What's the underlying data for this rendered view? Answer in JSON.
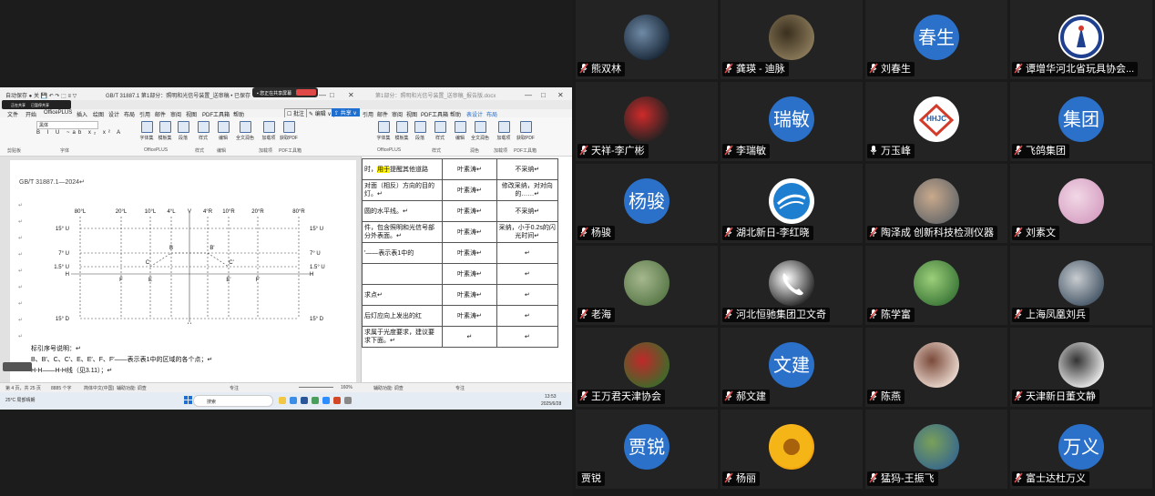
{
  "shared_screen": {
    "share_bar": {
      "label": "▪ 您正在共享屏幕",
      "stop_label": "停止共享"
    },
    "mini_toolbar": {
      "items": [
        "正在共享",
        "已暂停共享"
      ]
    },
    "title_left": "自动保存 ● 关 💾 ↶ ↷ ⬚ ≡ ▽",
    "title_doc": "GB/T 31887.1 第1部分：照明和光信号装置_送审稿 • 已保存 ∨",
    "title_doc_right": "第1部分：照明和光信号装置_送审稿_报告版.docx",
    "window_buttons": [
      "—",
      "□",
      "✕"
    ],
    "menu_left": [
      "文件",
      "开始",
      "OfficePLUS",
      "插入",
      "绘图",
      "设计",
      "布局",
      "引用",
      "邮件",
      "审阅",
      "视图",
      "PDF工具箱",
      "帮助"
    ],
    "menu_right": [
      "引用",
      "邮件",
      "审阅",
      "视图",
      "PDF工具箱",
      "帮助",
      "表设计",
      "布局"
    ],
    "ribbon_buttons": {
      "comment": "☐ 批注",
      "edit": "✎ 编辑 ∨",
      "share": "⇪ 共享 ∨"
    },
    "font_name": "黑体",
    "format_row": "B I U ~ab x₂ x² A",
    "ribbon_items": [
      "字体集",
      "模板集",
      "段落",
      "样式",
      "编辑",
      "全文润色",
      "加载项",
      "获取PDF"
    ],
    "ribbon_groups": [
      "剪贴板",
      "字体",
      "OfficePLUS",
      "样式",
      "编辑",
      "加载项",
      "PDF工具箱"
    ],
    "ribbon_items_right": [
      "字体集",
      "模板集",
      "段落",
      "样式",
      "编辑",
      "全文润色",
      "加载项",
      "获取PDF"
    ],
    "ribbon_groups_right": [
      "OfficePLUS",
      "样式",
      "润色",
      "加载项",
      "PDF工具箱"
    ],
    "doc_header": "GB/T 31887.1—2024↵",
    "diagram": {
      "top_labels": [
        "80°L",
        "20°L",
        "10°L",
        "4°L",
        "V",
        "4°R",
        "10°R",
        "20°R",
        "80°R"
      ],
      "left_labels": [
        "15° U",
        "7° U",
        "1.5° U",
        "H",
        "15° D"
      ],
      "right_labels": [
        "15° U",
        "7° U",
        "1.5° U",
        "H",
        "15° D"
      ],
      "points": [
        "B",
        "B'",
        "C",
        "C'",
        "F",
        "E",
        "E'",
        "F'"
      ],
      "bottom_v": "V"
    },
    "doc_lines": [
      "标引序号说明：↵",
      "B、B′、C、C′、E、E′、F、F′——表示表1中的区域的各个点；↵",
      "H-H——H-H线（见3.11）；↵"
    ],
    "right_table": [
      {
        "c1": "时，用于提醒其他道路",
        "c1_hl": "用于",
        "c2": "叶素涛↵",
        "c3": "不采纳↵"
      },
      {
        "c1": "对面（相反）方向的目的灯。↵",
        "c2": "叶素涛↵",
        "c3": "修改采纳，对对向的……↵"
      },
      {
        "c1": "圆的水平线。↵",
        "c2": "叶素涛↵",
        "c3": "不采纳↵"
      },
      {
        "c1": "件，包含照明和光信号部分外表面。↵",
        "c2": "叶素涛↵",
        "c3": "采纳，小于0.2s的闪光时间↵"
      },
      {
        "c1": "′——表示表1中的",
        "c2": "叶素涛↵",
        "c3": "↵"
      },
      {
        "c1": "",
        "c2": "叶素涛↵",
        "c3": "↵"
      },
      {
        "c1": "求点↵",
        "c2": "叶素涛↵",
        "c3": "↵"
      },
      {
        "c1": "后灯应向上发出的红",
        "c2": "叶素涛↵",
        "c3": "↵"
      },
      {
        "c1": "求属于光度要求，建议要求下面。↵",
        "c2": "↵",
        "c3": "↵"
      }
    ],
    "status_left": [
      "第 4 页，共 25 页",
      "8885 个字",
      "简体中文(中国)",
      "辅助功能: 调查"
    ],
    "status_right": [
      "辅助功能: 调查",
      "专注",
      "160%"
    ],
    "taskbar": {
      "weather": "25°C 局部晴朗",
      "search_placeholder": "搜索",
      "clock_time": "13:53",
      "clock_date": "2025/6/28"
    }
  },
  "participants": [
    {
      "name": "熊双林",
      "muted": true,
      "avatar_type": "photo",
      "photo": "night-city"
    },
    {
      "name": "龚瑛 - 迪脉",
      "muted": true,
      "avatar_type": "photo",
      "photo": "tree-silhouette"
    },
    {
      "name": "刘春生",
      "muted": true,
      "avatar_type": "text",
      "avatar_text": "春生"
    },
    {
      "name": "谭增华河北省玩具协会...",
      "muted": true,
      "avatar_type": "logo",
      "photo": "emblem"
    },
    {
      "name": "天祥-李广彬",
      "muted": true,
      "avatar_type": "photo",
      "photo": "mushroom-character"
    },
    {
      "name": "李瑞敏",
      "muted": true,
      "avatar_type": "text",
      "avatar_text": "瑞敏"
    },
    {
      "name": "万玉峰",
      "muted": false,
      "avatar_type": "logo",
      "photo": "hhjc-logo",
      "logo_text": "HHJC"
    },
    {
      "name": "飞鸽集团",
      "muted": true,
      "avatar_type": "text",
      "avatar_text": "集团"
    },
    {
      "name": "杨骏",
      "muted": true,
      "avatar_type": "text",
      "avatar_text": "杨骏"
    },
    {
      "name": "湖北新日-李红晓",
      "muted": true,
      "avatar_type": "logo",
      "photo": "blue-swoosh-logo"
    },
    {
      "name": "陶泽成 创新科技检测仪器",
      "muted": true,
      "avatar_type": "photo",
      "photo": "child-camera"
    },
    {
      "name": "刘素文",
      "muted": true,
      "avatar_type": "photo",
      "photo": "pink-flowers"
    },
    {
      "name": "老海",
      "muted": true,
      "avatar_type": "photo",
      "photo": "village-scene"
    },
    {
      "name": "河北恒驰集团卫文奇",
      "muted": true,
      "avatar_type": "logo",
      "photo": "phone-icon"
    },
    {
      "name": "陈学富",
      "muted": true,
      "avatar_type": "photo",
      "photo": "green-bamboo"
    },
    {
      "name": "上海凤凰刘兵",
      "muted": true,
      "avatar_type": "photo",
      "photo": "mountain-sky"
    },
    {
      "name": "王万君天津协会",
      "muted": true,
      "avatar_type": "photo",
      "photo": "red-fruits"
    },
    {
      "name": "郝文建",
      "muted": true,
      "avatar_type": "text",
      "avatar_text": "文建"
    },
    {
      "name": "陈燕",
      "muted": true,
      "avatar_type": "photo",
      "photo": "little-girl"
    },
    {
      "name": "天津新日董文静",
      "muted": true,
      "avatar_type": "photo",
      "photo": "white-cat"
    },
    {
      "name": "贾锐",
      "muted": null,
      "avatar_type": "text",
      "avatar_text": "贾锐"
    },
    {
      "name": "杨丽",
      "muted": true,
      "avatar_type": "photo",
      "photo": "sunflower"
    },
    {
      "name": "猛犸-王振飞",
      "muted": true,
      "avatar_type": "photo",
      "photo": "lake-landscape"
    },
    {
      "name": "富士达杜万义",
      "muted": true,
      "avatar_type": "text",
      "avatar_text": "万义"
    }
  ],
  "colors": {
    "avatar_blue": "#2b70c9",
    "tile_bg": "#232323",
    "page_bg": "#1a1a1a",
    "share_stop": "#e04848",
    "highlight": "#fff200"
  }
}
